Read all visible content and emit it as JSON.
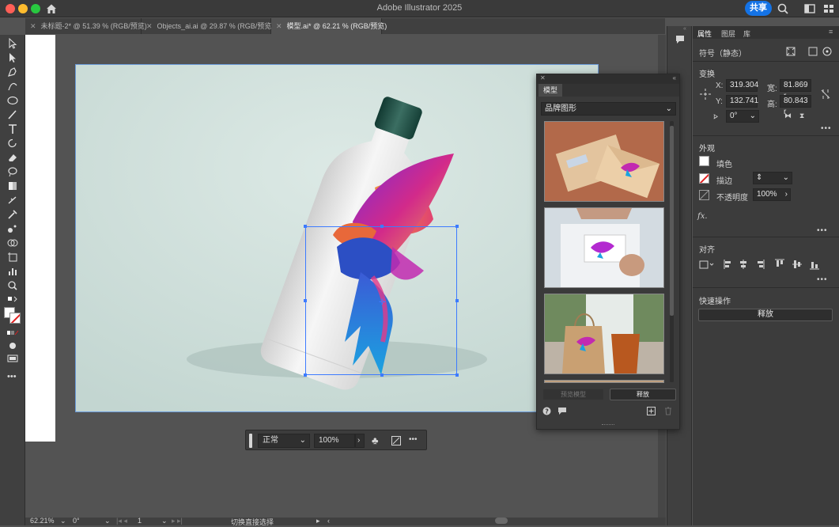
{
  "app": {
    "title": "Adobe Illustrator 2025",
    "share_label": "共享"
  },
  "tabs": [
    {
      "label": "未标题-2* @ 51.39 % (RGB/预览)"
    },
    {
      "label": "Objects_ai.ai @ 29.87 % (RGB/预览)"
    },
    {
      "label": "模型.ai* @ 62.21 % (RGB/预览)"
    }
  ],
  "bottom_bar": {
    "blend_mode": "正常",
    "opacity": "100%"
  },
  "status": {
    "zoom": "62.21%",
    "rotation": "0°",
    "artboard": "1",
    "tool_hint": "切换直接选择"
  },
  "properties": {
    "tabs": [
      "属性",
      "图层",
      "库"
    ],
    "symbol_title": "符号（静态）",
    "transform": {
      "title": "变换",
      "x_label": "X:",
      "x": "319.304",
      "y_label": "Y:",
      "y": "132.741",
      "w_label": "宽:",
      "w": "81.869 r",
      "h_label": "高:",
      "h": "80.843 r",
      "angle": "0°"
    },
    "appearance": {
      "title": "外观",
      "fill_label": "填色",
      "stroke_label": "描边",
      "opacity_label": "不透明度",
      "opacity": "100%",
      "fx": "fx."
    },
    "align": {
      "title": "对齐"
    },
    "quick": {
      "title": "快速操作",
      "release": "释放"
    }
  },
  "mockup_panel": {
    "tab": "模型",
    "category": "品牌图形",
    "preview_btn": "预览模型",
    "release_btn": "释放"
  }
}
